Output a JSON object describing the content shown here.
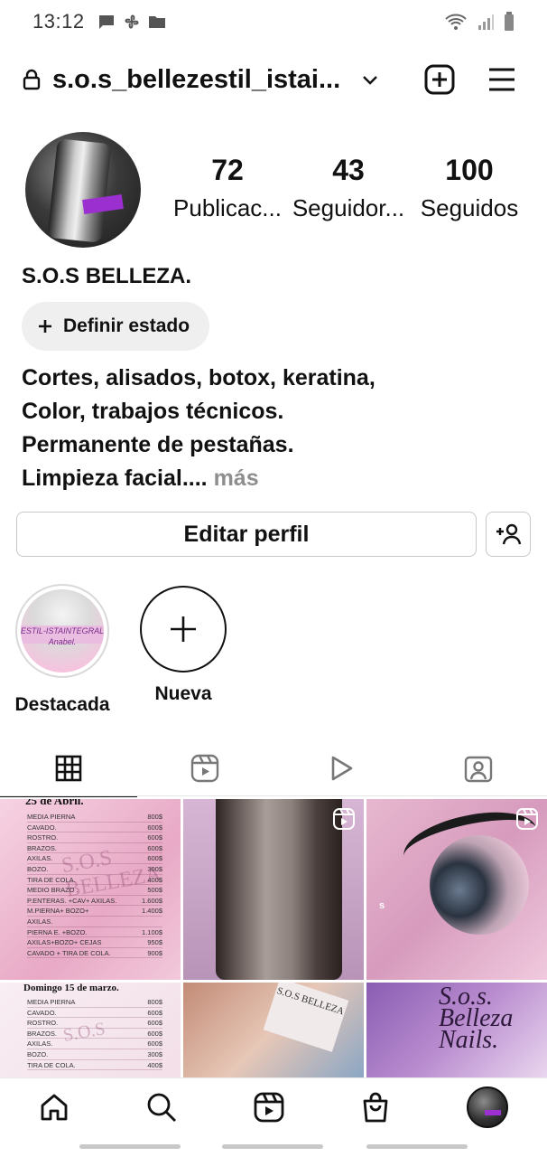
{
  "status_bar": {
    "time": "13:12"
  },
  "header": {
    "username": "s.o.s_bellezestil_istai..."
  },
  "profile": {
    "stats": [
      {
        "value": "72",
        "label": "Publicac..."
      },
      {
        "value": "43",
        "label": "Seguidor..."
      },
      {
        "value": "100",
        "label": "Seguidos"
      }
    ],
    "display_name": "S.O.S BELLEZA.",
    "status_button": "Definir estado",
    "bio_lines": [
      "Cortes, alisados, botox, keratina,",
      "Color, trabajos técnicos.",
      "Permanente de pestañas.",
      "Limpieza facial.... "
    ],
    "bio_more": "más",
    "edit_button": "Editar perfil"
  },
  "highlights": [
    {
      "label": "Destacada",
      "cover_text": "ESTIL-ISTAINTEGRAL Anabel."
    },
    {
      "label": "Nueva"
    }
  ],
  "tabs": [
    "grid-icon",
    "reels-icon",
    "video-icon",
    "tagged-icon"
  ],
  "posts": {
    "menu1": {
      "title": "25 de Abril.",
      "watermark": "S.O.S BELLEZA",
      "rows": [
        [
          "MEDIA PIERNA",
          "800$"
        ],
        [
          "CAVADO.",
          "600$"
        ],
        [
          "ROSTRO.",
          "600$"
        ],
        [
          "BRAZOS.",
          "600$"
        ],
        [
          "AXILAS.",
          "600$"
        ],
        [
          "BOZO.",
          "300$"
        ],
        [
          "TIRA DE COLA.",
          "400$"
        ],
        [
          "MEDIO BRAZO .",
          "500$"
        ],
        [
          "P.ENTERAS. +CAV+ AXILAS.",
          "1.600$"
        ],
        [
          "M.PIERNA+ BOZO+",
          "1.400$"
        ],
        [
          "AXILAS.",
          ""
        ],
        [
          "PIERNA E. +BOZO.",
          "1.100$"
        ],
        [
          "AXILAS+BOZO+ CEJAS",
          "950$"
        ],
        [
          "CAVADO + TIRA DE COLA.",
          "900$"
        ]
      ]
    },
    "eye_label": "s",
    "menu2": {
      "title": "Domingo 15 de marzo.",
      "watermark": "S.O.S",
      "rows": [
        [
          "MEDIA PIERNA",
          "800$"
        ],
        [
          "CAVADO.",
          "600$"
        ],
        [
          "ROSTRO.",
          "600$"
        ],
        [
          "BRAZOS.",
          "600$"
        ],
        [
          "AXILAS.",
          "600$"
        ],
        [
          "BOZO.",
          "300$"
        ],
        [
          "TIRA DE COLA.",
          "400$"
        ]
      ]
    },
    "nails_logo": "S.O.S BELLEZA",
    "nails2_text": "S.o.s. Belleza Nails."
  },
  "colors": {
    "accent": "#9b2fd0",
    "text": "#111111",
    "muted": "#8e8e8e"
  }
}
